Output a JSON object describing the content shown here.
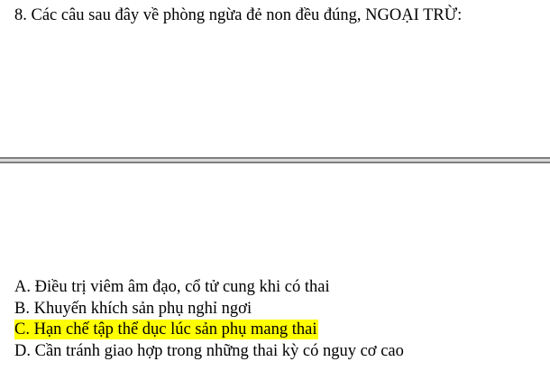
{
  "question": {
    "text": "8. Các câu sau đây về phòng ngừa đẻ non đều đúng, NGOẠI TRỪ:"
  },
  "options": [
    {
      "text": "A. Điều trị viêm âm đạo, cổ tử cung khi có thai",
      "highlighted": false
    },
    {
      "text": "B. Khuyến khích sản phụ nghỉ ngơi",
      "highlighted": false
    },
    {
      "text": "C. Hạn chế tập thể dục lúc sản phụ mang thai",
      "highlighted": true
    },
    {
      "text": "D. Cần tránh giao hợp trong những thai kỳ có nguy cơ cao",
      "highlighted": false
    }
  ],
  "colors": {
    "highlight": "#ffff00",
    "divider": "#7f7f7f"
  }
}
